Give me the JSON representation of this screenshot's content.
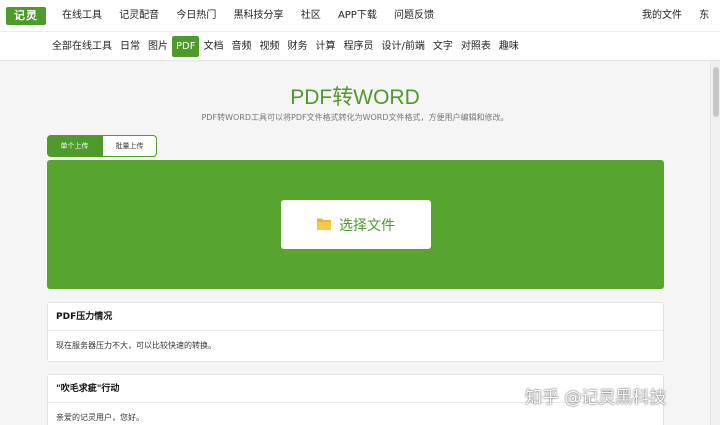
{
  "header": {
    "logo_text": "记灵",
    "nav": [
      "在线工具",
      "记灵配音",
      "今日热门",
      "黑科技分享",
      "社区",
      "APP下载",
      "问题反馈"
    ],
    "right_nav": [
      "我的文件",
      "东"
    ]
  },
  "categories": {
    "items": [
      "全部在线工具",
      "日常",
      "图片",
      "PDF",
      "文档",
      "音频",
      "视频",
      "财务",
      "计算",
      "程序员",
      "设计/前端",
      "文字",
      "对照表",
      "趣味"
    ],
    "active": "PDF"
  },
  "main": {
    "title": "PDF转WORD",
    "subtitle": "PDF转WORD工具可以将PDF文件格式转化为WORD文件格式，方便用户编辑和修改。",
    "tabs": [
      "单个上传",
      "批量上传"
    ],
    "upload_button": "选择文件"
  },
  "cards": [
    {
      "title": "PDF压力情况",
      "body": "现在服务器压力不大，可以比较快速的转换。"
    },
    {
      "title": "\"吹毛求疵\"行动",
      "body": "亲爱的记灵用户，您好。"
    }
  ],
  "watermark": "知乎 @记灵黑科技",
  "colors": {
    "accent": "#4e9a2a",
    "upload_bg": "#57a52e",
    "folder": "#f0b429"
  }
}
